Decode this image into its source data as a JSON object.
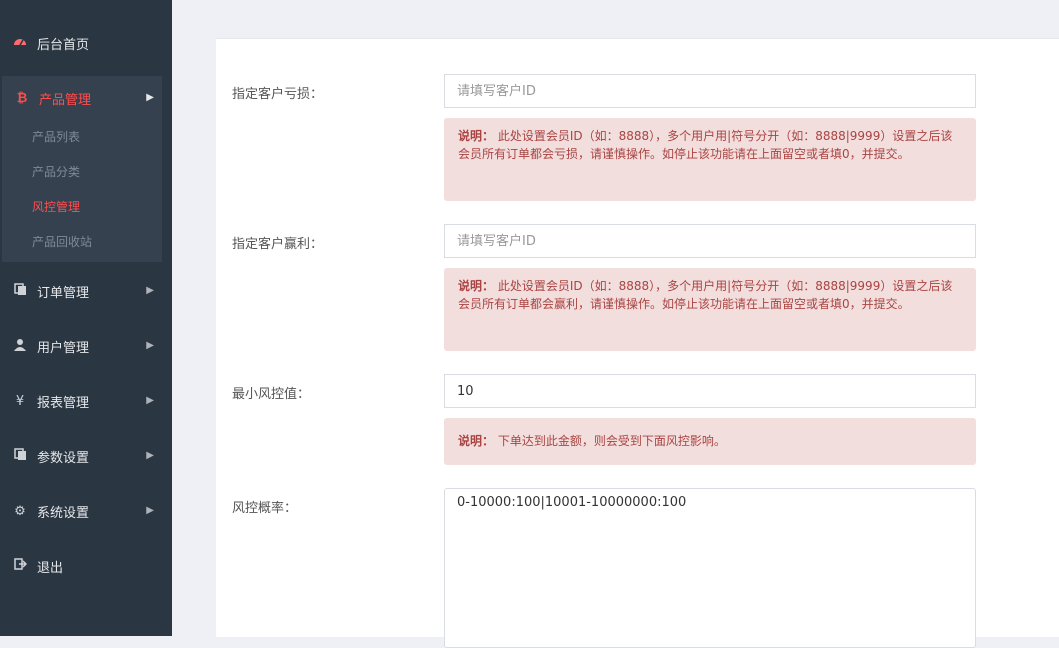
{
  "sidebar": {
    "items": [
      {
        "label": "后台首页",
        "icon": "dashboard-icon"
      },
      {
        "label": "产品管理",
        "icon": "bitcoin-icon"
      },
      {
        "label": "订单管理",
        "icon": "copy-icon"
      },
      {
        "label": "用户管理",
        "icon": "user-icon"
      },
      {
        "label": "报表管理",
        "icon": "yen-icon"
      },
      {
        "label": "参数设置",
        "icon": "copy-icon"
      },
      {
        "label": "系统设置",
        "icon": "gears-icon"
      },
      {
        "label": "退出",
        "icon": "sign-out-icon"
      }
    ],
    "submenu": [
      "产品列表",
      "产品分类",
      "风控管理",
      "产品回收站"
    ]
  },
  "form": {
    "loss": {
      "label": "指定客户亏损：",
      "placeholder": "请填写客户ID",
      "note_title": "说明：",
      "note_text": "此处设置会员ID（如：8888），多个用户用|符号分开（如：8888|9999）设置之后该会员所有订单都会亏损，请谨慎操作。如停止该功能请在上面留空或者填0，并提交。"
    },
    "profit": {
      "label": "指定客户赢利：",
      "placeholder": "请填写客户ID",
      "note_title": "说明：",
      "note_text": "此处设置会员ID（如：8888），多个用户用|符号分开（如：8888|9999）设置之后该会员所有订单都会赢利，请谨慎操作。如停止该功能请在上面留空或者填0，并提交。"
    },
    "min_value": {
      "label": "最小风控值：",
      "value": "10",
      "note_title": "说明：",
      "note_text": "下单达到此金额，则会受到下面风控影响。"
    },
    "probability": {
      "label": "风控概率：",
      "value": "0-10000:100|10001-10000000:100"
    }
  },
  "colors": {
    "sidebar_bg": "#2b3643",
    "active_red": "#ff4d4d",
    "note_bg": "#f3dede",
    "note_text": "#a94442"
  }
}
